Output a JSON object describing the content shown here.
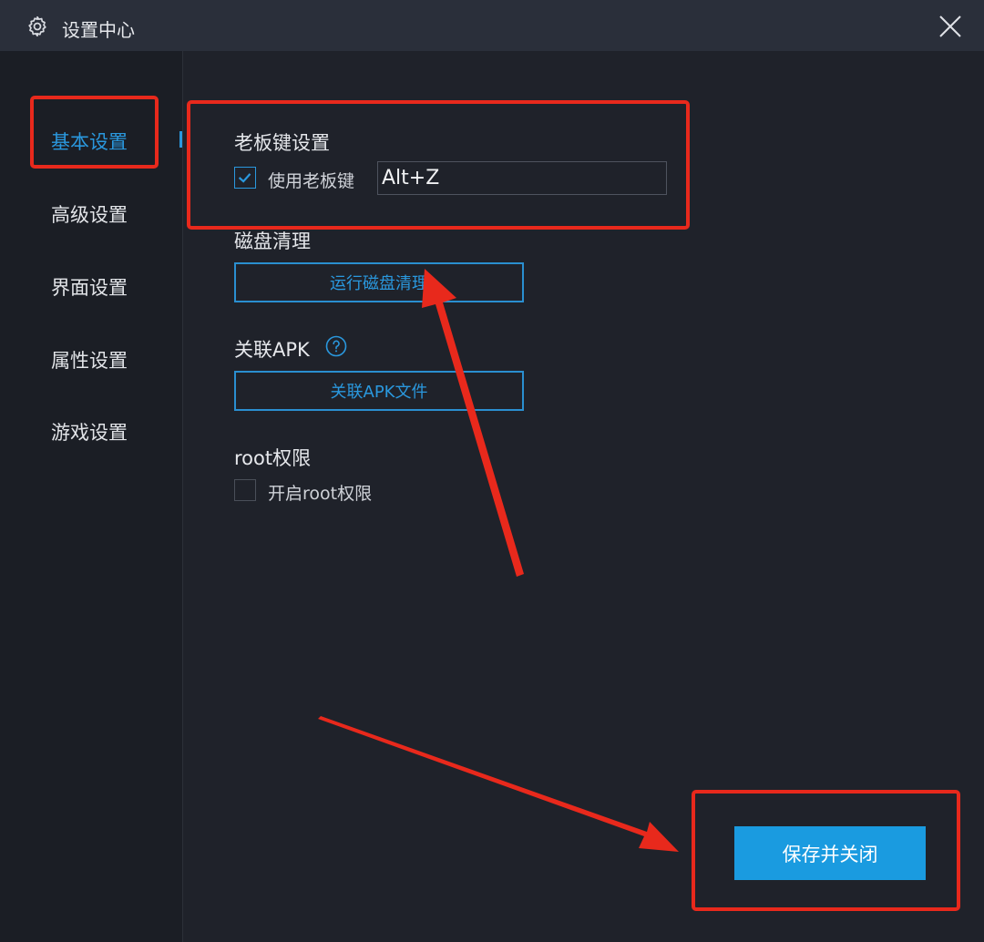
{
  "window": {
    "title": "设置中心",
    "title_icon": "gear-icon",
    "close_icon": "close-icon"
  },
  "sidebar": {
    "items": [
      {
        "label": "基本设置",
        "active": true
      },
      {
        "label": "高级设置",
        "active": false
      },
      {
        "label": "界面设置",
        "active": false
      },
      {
        "label": "属性设置",
        "active": false
      },
      {
        "label": "游戏设置",
        "active": false
      }
    ]
  },
  "boss_key": {
    "section_title": "老板键设置",
    "checkbox_label": "使用老板键",
    "checked": true,
    "value": "Alt+Z"
  },
  "disk_clean": {
    "section_title": "磁盘清理",
    "button_label": "运行磁盘清理"
  },
  "apk": {
    "section_title": "关联APK",
    "help_icon": "help-circle-icon",
    "button_label": "关联APK文件"
  },
  "root": {
    "section_title": "root权限",
    "checkbox_label": "开启root权限",
    "checked": false
  },
  "footer": {
    "save_label": "保存并关闭"
  },
  "colors": {
    "background": "#1f222a",
    "titlebar": "#2a2f3a",
    "accent": "#2a98de",
    "primary_button": "#1a9be0",
    "annotation_red": "#e8291c"
  }
}
